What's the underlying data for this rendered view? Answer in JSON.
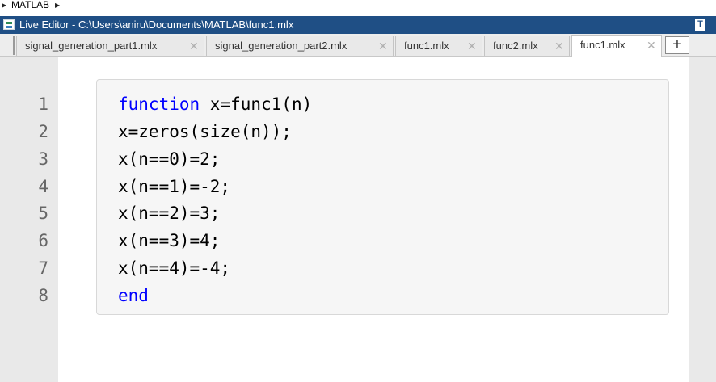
{
  "breadcrumb": {
    "label": "MATLAB"
  },
  "window": {
    "title": "Live Editor - C:\\Users\\aniru\\Documents\\MATLAB\\func1.mlx"
  },
  "tabs": [
    {
      "label": "signal_generation_part1.mlx",
      "close": "✕"
    },
    {
      "label": "signal_generation_part2.mlx",
      "close": "✕"
    },
    {
      "label": "func1.mlx",
      "close": "✕"
    },
    {
      "label": "func2.mlx",
      "close": "✕"
    },
    {
      "label": "func1.mlx",
      "close": "✕",
      "active": true
    }
  ],
  "add_tab_label": "+",
  "window_button_label": "T",
  "editor": {
    "line_numbers": [
      "1",
      "2",
      "3",
      "4",
      "5",
      "6",
      "7",
      "8"
    ],
    "lines": [
      {
        "keyword": "function",
        "rest": " x=func1(n)"
      },
      {
        "keyword": "",
        "rest": "x=zeros(size(n));"
      },
      {
        "keyword": "",
        "rest": "x(n==0)=2;"
      },
      {
        "keyword": "",
        "rest": "x(n==1)=-2;"
      },
      {
        "keyword": "",
        "rest": "x(n==2)=3;"
      },
      {
        "keyword": "",
        "rest": "x(n==3)=4;"
      },
      {
        "keyword": "",
        "rest": "x(n==4)=-4;"
      },
      {
        "keyword": "end",
        "rest": ""
      }
    ]
  },
  "colors": {
    "titlebar": "#1f4f85",
    "keyword": "#0000ff"
  }
}
